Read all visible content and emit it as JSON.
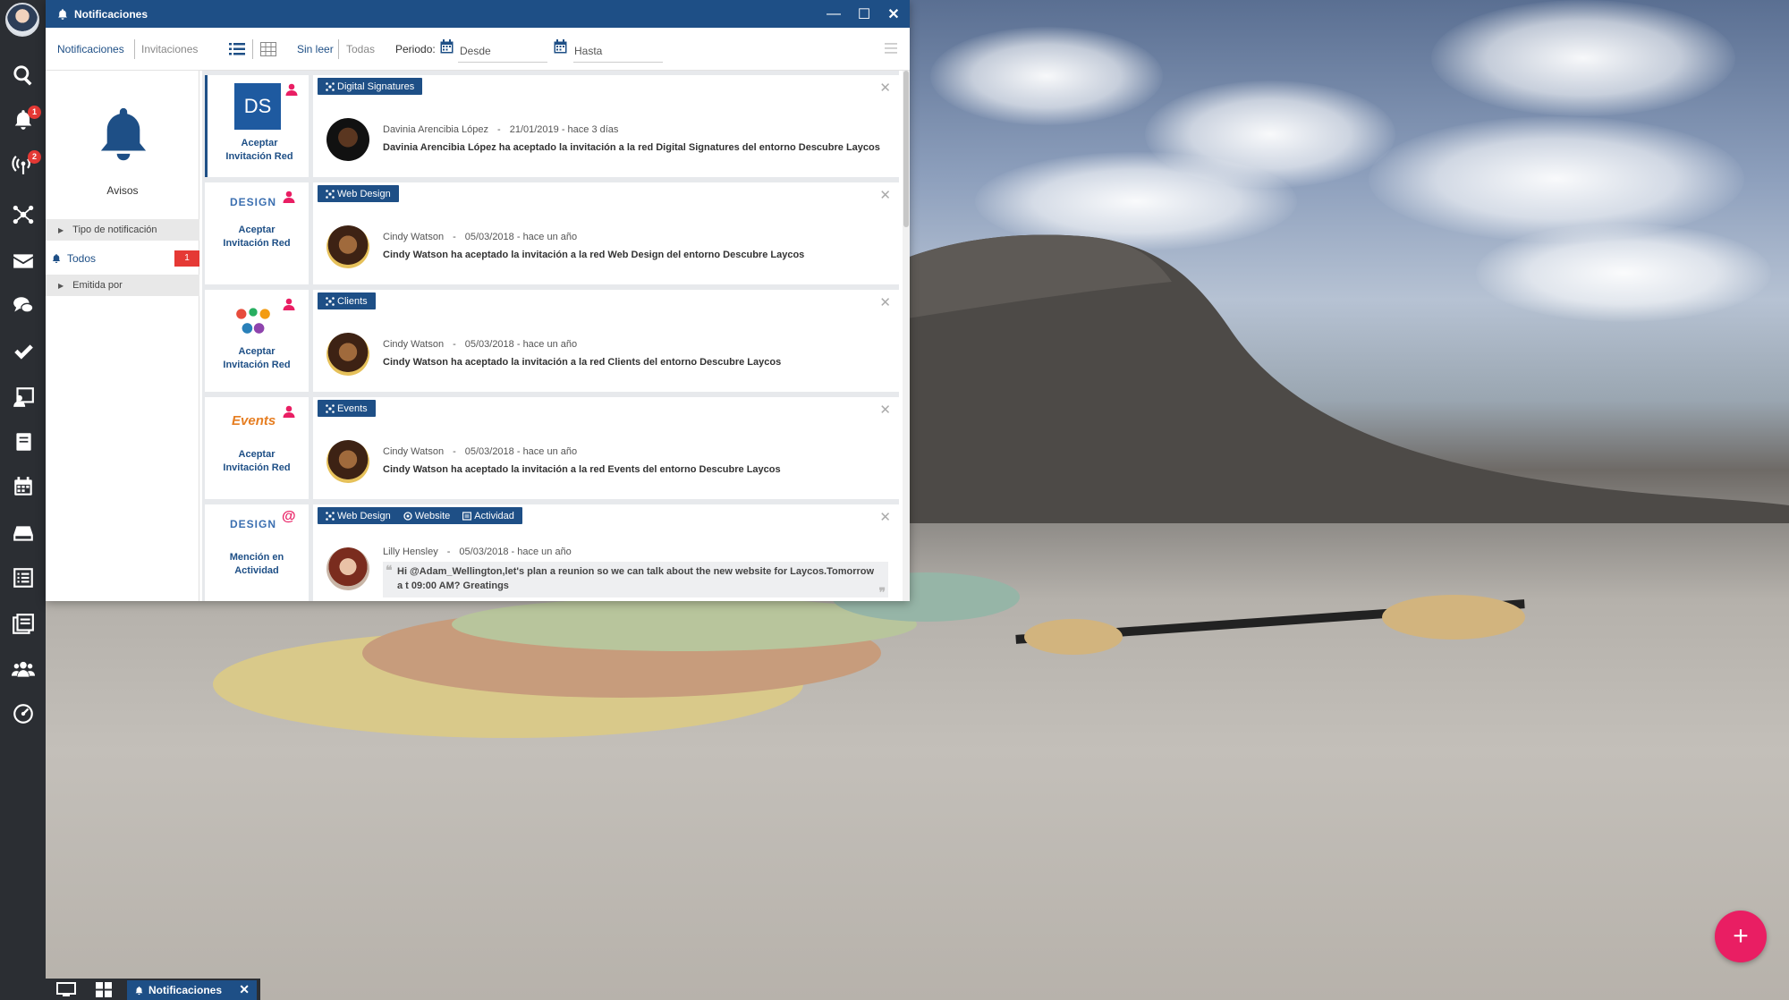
{
  "window": {
    "title": "Notificaciones",
    "controls": {
      "minimize": "—",
      "maximize": "☐",
      "close": "✕"
    }
  },
  "toolbar": {
    "tab_notifications": "Notificaciones",
    "tab_invitations": "Invitaciones",
    "filter_unread": "Sin leer",
    "filter_all": "Todas",
    "period_label": "Periodo:",
    "from_placeholder": "Desde",
    "to_placeholder": "Hasta"
  },
  "sidebar": {
    "title": "Avisos",
    "type_filter": "Tipo de notificación",
    "all_label": "Todos",
    "all_count": "1",
    "issued_by": "Emitida por"
  },
  "dock": {
    "badges": {
      "notifications": "1",
      "signals": "2"
    },
    "items": [
      "search-icon",
      "bell-icon",
      "signal-icon",
      "network-icon",
      "mail-icon",
      "chat-icon",
      "check-icon",
      "contact-icon",
      "book-icon",
      "calendar-icon",
      "drive-icon",
      "list-icon",
      "news-icon",
      "group-icon",
      "dashboard-icon"
    ]
  },
  "notifications": [
    {
      "tags": [
        "Digital Signatures"
      ],
      "action": "Aceptar Invitación Red",
      "logo": "DS",
      "author": "Davinia Arencibia López",
      "date": "21/01/2019 - hace 3 días",
      "message": "Davinia Arencibia López ha aceptado la invitación a la red Digital Signatures del entorno Descubre Laycos"
    },
    {
      "tags": [
        "Web Design"
      ],
      "action": "Aceptar Invitación Red",
      "logo": "DESIGN",
      "author": "Cindy Watson",
      "date": "05/03/2018 - hace un año",
      "message": "Cindy Watson ha aceptado la invitación a la red Web Design del entorno Descubre Laycos"
    },
    {
      "tags": [
        "Clients"
      ],
      "action": "Aceptar Invitación Red",
      "author": "Cindy Watson",
      "date": "05/03/2018 - hace un año",
      "message": "Cindy Watson ha aceptado la invitación a la red Clients del entorno Descubre Laycos"
    },
    {
      "tags": [
        "Events"
      ],
      "action": "Aceptar Invitación Red",
      "logo": "Events",
      "author": "Cindy Watson",
      "date": "05/03/2018 - hace un año",
      "message": "Cindy Watson ha aceptado la invitación a la red Events del entorno Descubre Laycos"
    },
    {
      "tags": [
        "Web Design",
        "Website",
        "Actividad"
      ],
      "action": "Mención en Actividad",
      "logo": "DESIGN",
      "author": "Lilly Hensley",
      "date": "05/03/2018 - hace un año",
      "message": "Hi @Adam_Wellington,let's plan a reunion so we can talk about the new website for Laycos.Tomorrow a t 09:00 AM? Greatings"
    }
  ],
  "taskbar": {
    "active_task": "Notificaciones"
  },
  "fab": {
    "label": "+"
  },
  "colors": {
    "primary": "#1e4f86",
    "accent": "#e91e63",
    "badge": "#e53935",
    "dock": "#2b2e33"
  }
}
